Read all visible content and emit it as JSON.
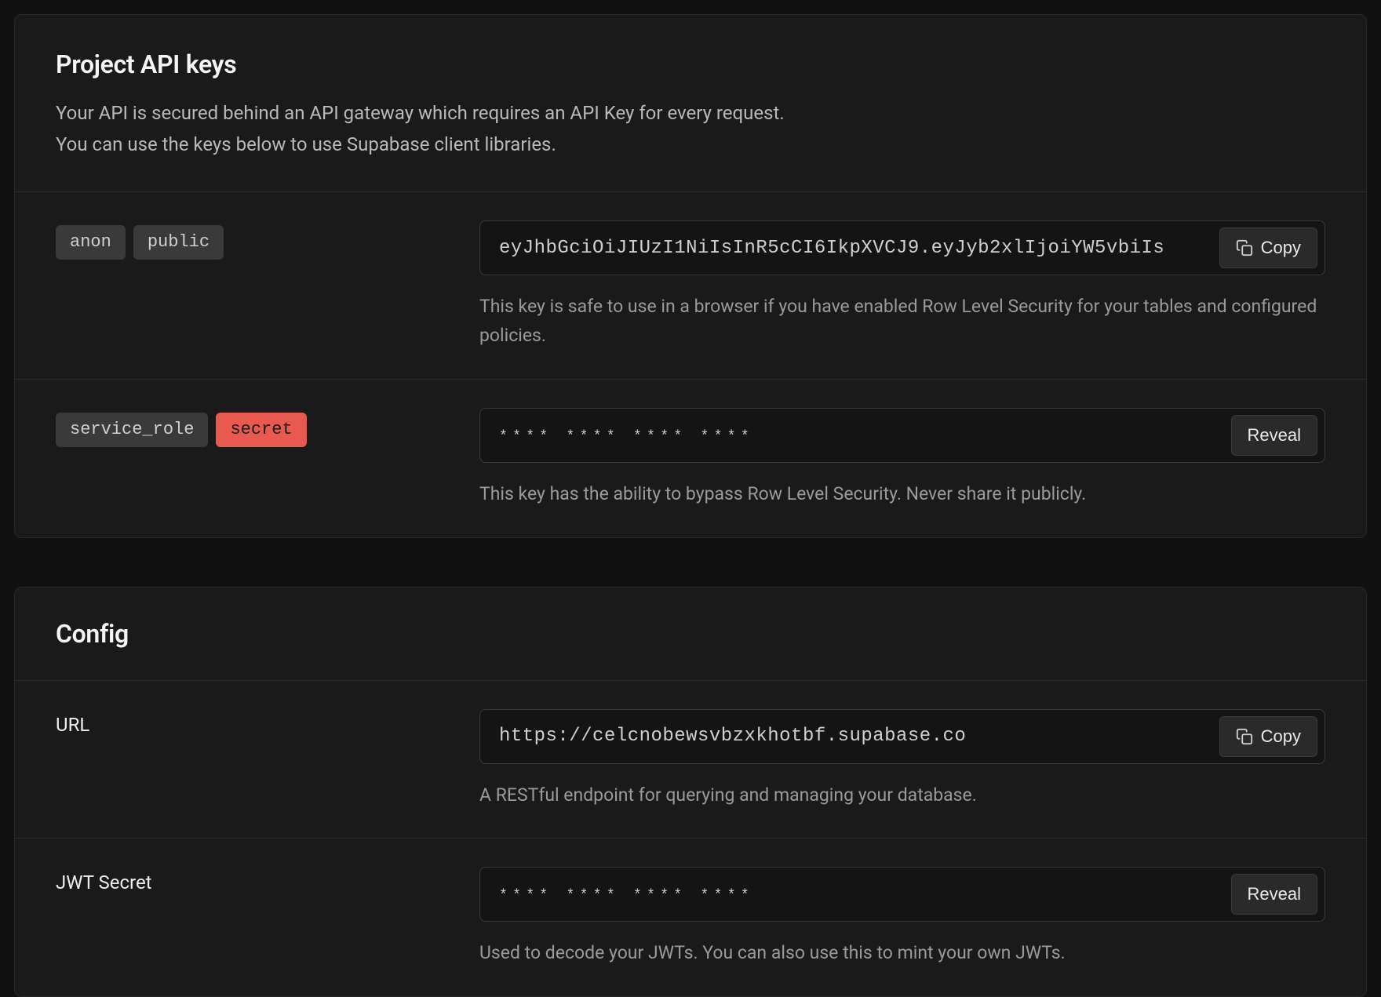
{
  "api_keys": {
    "title": "Project API keys",
    "description_line1": "Your API is secured behind an API gateway which requires an API Key for every request.",
    "description_line2": "You can use the keys below to use Supabase client libraries.",
    "anon": {
      "tag1": "anon",
      "tag2": "public",
      "value": "eyJhbGciOiJIUzI1NiIsInR5cCI6IkpXVCJ9.eyJyb2xlIjoiYW5vbiIs",
      "button": "Copy",
      "help": "This key is safe to use in a browser if you have enabled Row Level Security for your tables and configured policies."
    },
    "service_role": {
      "tag1": "service_role",
      "tag2": "secret",
      "value": "**** **** **** ****",
      "button": "Reveal",
      "help": "This key has the ability to bypass Row Level Security. Never share it publicly."
    }
  },
  "config": {
    "title": "Config",
    "url": {
      "label": "URL",
      "value": "https://celcnobewsvbzxkhotbf.supabase.co",
      "button": "Copy",
      "help": "A RESTful endpoint for querying and managing your database."
    },
    "jwt": {
      "label": "JWT Secret",
      "value": "**** **** **** ****",
      "button": "Reveal",
      "help": "Used to decode your JWTs. You can also use this to mint your own JWTs."
    }
  }
}
